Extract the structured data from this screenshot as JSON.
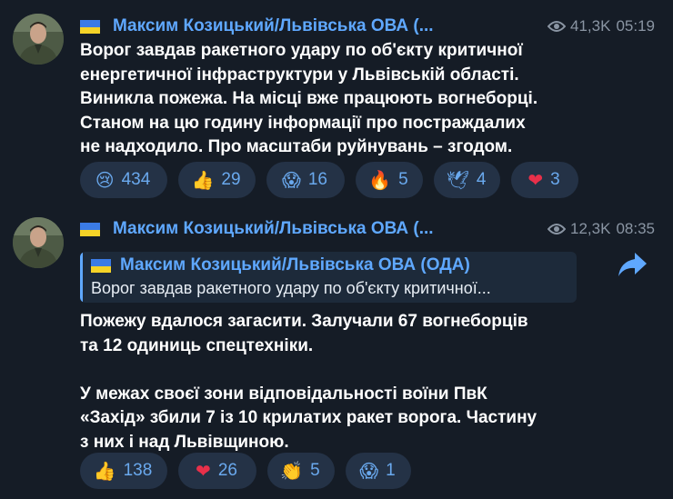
{
  "posts": [
    {
      "author": "Максим Козицький/Львівська ОВА (...",
      "views": "41,3K",
      "time": "05:19",
      "text": "Ворог завдав ракетного удару по об'єкту критичної\nенергетичної інфраструктури у Львівській області.\nВиникла пожежа. На місці вже працюють вогнеборці.\nСтаном на цю годину інформації про постраждалих\nне надходило. Про масштаби руйнувань – згодом.",
      "reactions": [
        {
          "emoji": "😢",
          "count": "434"
        },
        {
          "emoji": "👍",
          "count": "29"
        },
        {
          "emoji": "😱",
          "count": "16"
        },
        {
          "emoji": "🔥",
          "count": "5"
        },
        {
          "emoji": "🕊",
          "count": "4"
        },
        {
          "emoji": "❤",
          "count": "3"
        }
      ]
    },
    {
      "author": "Максим Козицький/Львівська ОВА (...",
      "views": "12,3K",
      "time": "08:35",
      "reply": {
        "author": "Максим Козицький/Львівська ОВА (ОДА)",
        "text": "Ворог завдав ракетного удару по об'єкту критичної..."
      },
      "text": "Пожежу вдалося загасити. Залучали 67 вогнеборців\nта 12 одиниць спецтехніки.\n\nУ межах своєї зони відповідальності воїни ПвК\n«Захід» збили 7 із 10 крилатих ракет ворога. Частину\nз них і над Львівщиною.",
      "reactions": [
        {
          "emoji": "👍",
          "count": "138"
        },
        {
          "emoji": "❤",
          "count": "26"
        },
        {
          "emoji": "👏",
          "count": "5"
        },
        {
          "emoji": "😱",
          "count": "1"
        }
      ]
    }
  ],
  "icons": {
    "views": "eye-icon",
    "share": "share-arrow-icon",
    "flag": "ukraine-flag-icon"
  },
  "colors": {
    "background": "#151c26",
    "accent": "#5fa8ff",
    "reaction_bg": "#243246",
    "reaction_text": "#6aa9ee"
  }
}
